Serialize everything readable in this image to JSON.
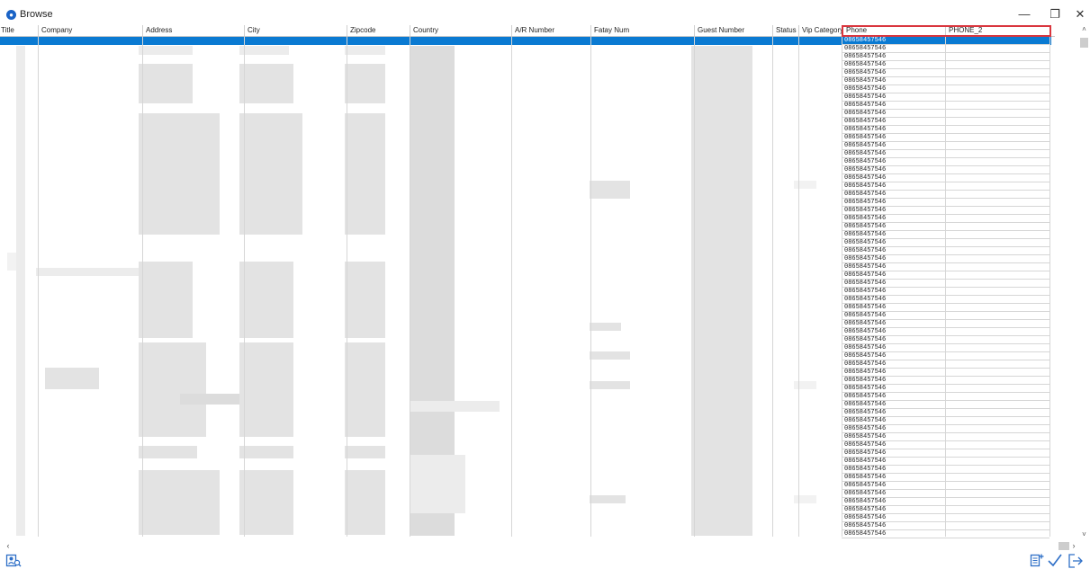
{
  "window": {
    "title": "Browse",
    "minimize_glyph": "—",
    "maximize_glyph": "❐",
    "close_glyph": "✕"
  },
  "grid": {
    "columns": [
      {
        "label": "Title"
      },
      {
        "label": "Company"
      },
      {
        "label": "Address"
      },
      {
        "label": "City"
      },
      {
        "label": "Zipcode"
      },
      {
        "label": "Country"
      },
      {
        "label": "A/R Number"
      },
      {
        "label": "Fatay Num"
      },
      {
        "label": "Guest Number"
      },
      {
        "label": "Status"
      },
      {
        "label": "Vip Category"
      },
      {
        "label": "Phone"
      },
      {
        "label": "PHONE_2"
      }
    ],
    "phone_value": "08658457546",
    "row_count": 62,
    "selected_row_index": 0
  },
  "footer": {
    "icons": [
      "search-person-icon",
      "add-record-icon",
      "confirm-check-icon",
      "exit-icon"
    ]
  },
  "colors": {
    "selection": "#0a7ad2",
    "highlight_border": "#d9363e",
    "accent": "#1a63c6"
  }
}
